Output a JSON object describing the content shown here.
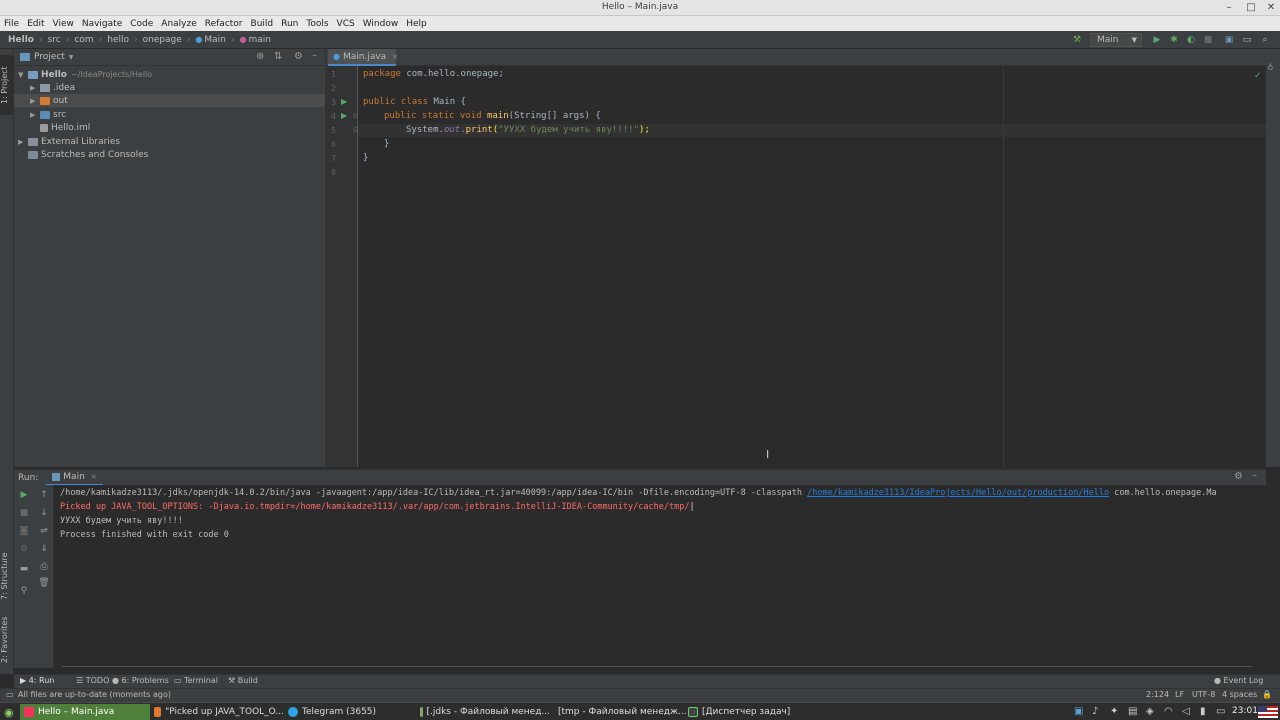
{
  "window": {
    "title": "Hello – Main.java",
    "minimize": "–",
    "maximize": "□",
    "close": "✕"
  },
  "menu": [
    "File",
    "Edit",
    "View",
    "Navigate",
    "Code",
    "Analyze",
    "Refactor",
    "Build",
    "Run",
    "Tools",
    "VCS",
    "Window",
    "Help"
  ],
  "breadcrumb": [
    "Hello",
    "src",
    "com",
    "hello",
    "onepage",
    "Main",
    "main"
  ],
  "run_config": "Main",
  "side_tabs": {
    "project": "1: Project",
    "structure": "7: Structure",
    "favorites": "2: Favorites"
  },
  "project_panel": {
    "title": "Project",
    "tree": [
      {
        "label": "Hello",
        "hint": "~/IdeaProjects/Hello",
        "depth": 0,
        "expanded": true,
        "icon": "module-folder-icon"
      },
      {
        "label": ".idea",
        "depth": 1,
        "expanded": false,
        "icon": "folder-icon"
      },
      {
        "label": "out",
        "depth": 1,
        "expanded": false,
        "icon": "excluded-folder-icon",
        "selected": true
      },
      {
        "label": "src",
        "depth": 1,
        "expanded": false,
        "icon": "source-folder-icon"
      },
      {
        "label": "Hello.iml",
        "depth": 1,
        "icon": "iml-file-icon"
      },
      {
        "label": "External Libraries",
        "depth": 0,
        "expanded": false,
        "icon": "library-icon"
      },
      {
        "label": "Scratches and Consoles",
        "depth": 0,
        "icon": "scratches-icon"
      }
    ]
  },
  "editor": {
    "tab": "Main.java",
    "lines": [
      "1",
      "2",
      "3",
      "4",
      "5",
      "6",
      "7",
      "8"
    ],
    "code": {
      "l1_kw": "package",
      "l1_rest": " com.hello.onepage;",
      "l3_kw": "public class",
      "l3_rest": " Main {",
      "l4_kw": "public static void",
      "l4_fn": "main",
      "l4_rest": "(String[] args) {",
      "l5_a": "System.",
      "l5_out": "out",
      "l5_b": ".",
      "l5_fn": "print",
      "l5_c": "(",
      "l5_str": "\"УУХХ будем учить яву!!!!\"",
      "l5_d": ");",
      "l6": "}",
      "l7": "}"
    }
  },
  "run_panel": {
    "label": "Run:",
    "tab": "Main",
    "console": {
      "line1_a": "/home/kamikadze3113/.jdks/openjdk-14.0.2/bin/java -javaagent:/app/idea-IC/lib/idea_rt.jar=40099:/app/idea-IC/bin -Dfile.encoding=UTF-8 -classpath ",
      "line1_link": "/home/kamikadze3113/IdeaProjects/Hello/out/production/Hello",
      "line1_b": " com.hello.onepage.Ma",
      "line2": "Picked up JAVA_TOOL_OPTIONS: -Djava.io.tmpdir=/home/kamikadze3113/.var/app/com.jetbrains.IntelliJ-IDEA-Community/cache/tmp/",
      "line3": "УУХХ будем учить яву!!!!",
      "line4": "Process finished with exit code 0"
    }
  },
  "tool_tabs": {
    "run": "4: Run",
    "todo": "TODO",
    "problems": "6: Problems",
    "terminal": "Terminal",
    "build": "Build",
    "event_log": "Event Log"
  },
  "status": {
    "message": "All files are up-to-date (moments ago)",
    "position": "2:124",
    "line_sep": "LF",
    "encoding": "UTF-8",
    "indent": "4 spaces"
  },
  "taskbar": {
    "items": [
      "Hello – Main.java",
      "\"Picked up JAVA_TOOL_O...",
      "Telegram (3655)",
      "[.jdks - Файловый менед...",
      "[tmp - Файловый менедж...",
      "[Диспетчер задач]"
    ],
    "clock": "23:01"
  },
  "colors": {
    "accent": "#4a88c7",
    "keyword": "#cc7832",
    "string": "#6a8759",
    "function": "#ffc66d",
    "error": "#ff6b68",
    "link": "#287bde",
    "taskbar_active": "#4f7f3a"
  }
}
